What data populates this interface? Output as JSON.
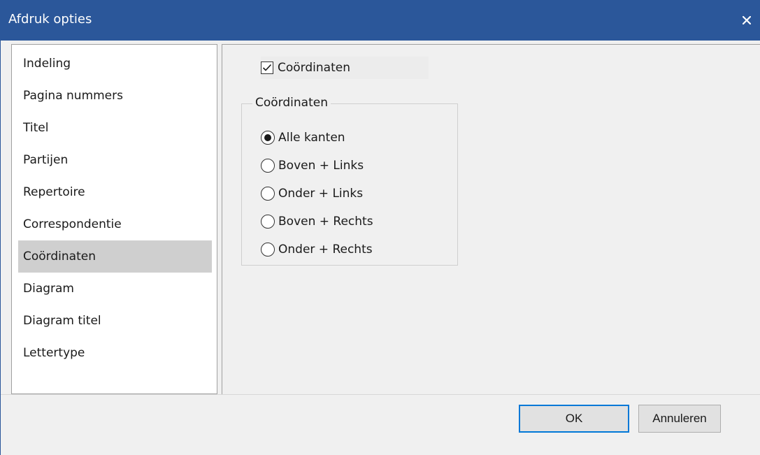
{
  "window": {
    "title": "Afdruk opties",
    "close_icon": "close-icon",
    "accent": "#2b579a"
  },
  "sidebar": {
    "items": [
      {
        "label": "Indeling",
        "selected": false
      },
      {
        "label": "Pagina nummers",
        "selected": false
      },
      {
        "label": "Titel",
        "selected": false
      },
      {
        "label": "Partijen",
        "selected": false
      },
      {
        "label": "Repertoire",
        "selected": false
      },
      {
        "label": "Correspondentie",
        "selected": false
      },
      {
        "label": "Coördinaten",
        "selected": true
      },
      {
        "label": "Diagram",
        "selected": false
      },
      {
        "label": "Diagram titel",
        "selected": false
      },
      {
        "label": "Lettertype",
        "selected": false
      }
    ]
  },
  "panel": {
    "checkbox": {
      "label": "Coördinaten",
      "checked": true
    },
    "group": {
      "legend": "Coördinaten",
      "options": [
        {
          "label": "Alle kanten",
          "selected": true
        },
        {
          "label": "Boven + Links",
          "selected": false
        },
        {
          "label": "Onder + Links",
          "selected": false
        },
        {
          "label": "Boven + Rechts",
          "selected": false
        },
        {
          "label": "Onder + Rechts",
          "selected": false
        }
      ]
    }
  },
  "footer": {
    "ok_label": "OK",
    "cancel_label": "Annuleren"
  }
}
